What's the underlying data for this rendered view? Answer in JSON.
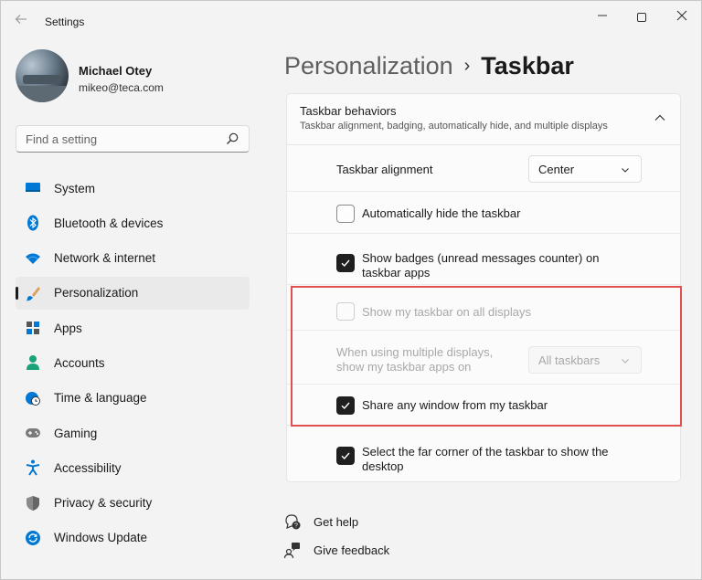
{
  "window": {
    "title": "Settings"
  },
  "profile": {
    "name": "Michael Otey",
    "email": "mikeo@teca.com"
  },
  "search": {
    "placeholder": "Find a setting"
  },
  "sidebar": {
    "items": [
      {
        "label": "System",
        "icon": "monitor-icon"
      },
      {
        "label": "Bluetooth & devices",
        "icon": "bluetooth-icon"
      },
      {
        "label": "Network & internet",
        "icon": "wifi-icon"
      },
      {
        "label": "Personalization",
        "icon": "brush-icon",
        "selected": true
      },
      {
        "label": "Apps",
        "icon": "apps-icon"
      },
      {
        "label": "Accounts",
        "icon": "person-icon"
      },
      {
        "label": "Time & language",
        "icon": "globe-clock-icon"
      },
      {
        "label": "Gaming",
        "icon": "gamepad-icon"
      },
      {
        "label": "Accessibility",
        "icon": "accessibility-icon"
      },
      {
        "label": "Privacy & security",
        "icon": "shield-icon"
      },
      {
        "label": "Windows Update",
        "icon": "refresh-icon"
      }
    ]
  },
  "breadcrumb": {
    "parent": "Personalization",
    "separator": "›",
    "current": "Taskbar"
  },
  "section": {
    "title": "Taskbar behaviors",
    "subtitle": "Taskbar alignment, badging, automatically hide, and multiple displays",
    "alignment": {
      "label": "Taskbar alignment",
      "value": "Center"
    },
    "auto_hide": {
      "label": "Automatically hide the taskbar",
      "checked": false
    },
    "badges": {
      "label_line1": "Show badges (unread messages counter) on",
      "label_line2": "taskbar apps",
      "checked": true
    },
    "all_displays": {
      "label": "Show my taskbar on all displays",
      "checked": false,
      "disabled": true
    },
    "multi_display": {
      "label_line1": "When using multiple displays,",
      "label_line2": "show my taskbar apps on",
      "value": "All taskbars",
      "disabled": true
    },
    "share_window": {
      "label": "Share any window from my taskbar",
      "checked": true
    },
    "far_corner": {
      "label_line1": "Select the far corner of the taskbar to show the",
      "label_line2": "desktop",
      "checked": true
    }
  },
  "footer": {
    "help": "Get help",
    "feedback": "Give feedback"
  },
  "colors": {
    "highlight": "#e05050",
    "accent": "#0067c0"
  }
}
